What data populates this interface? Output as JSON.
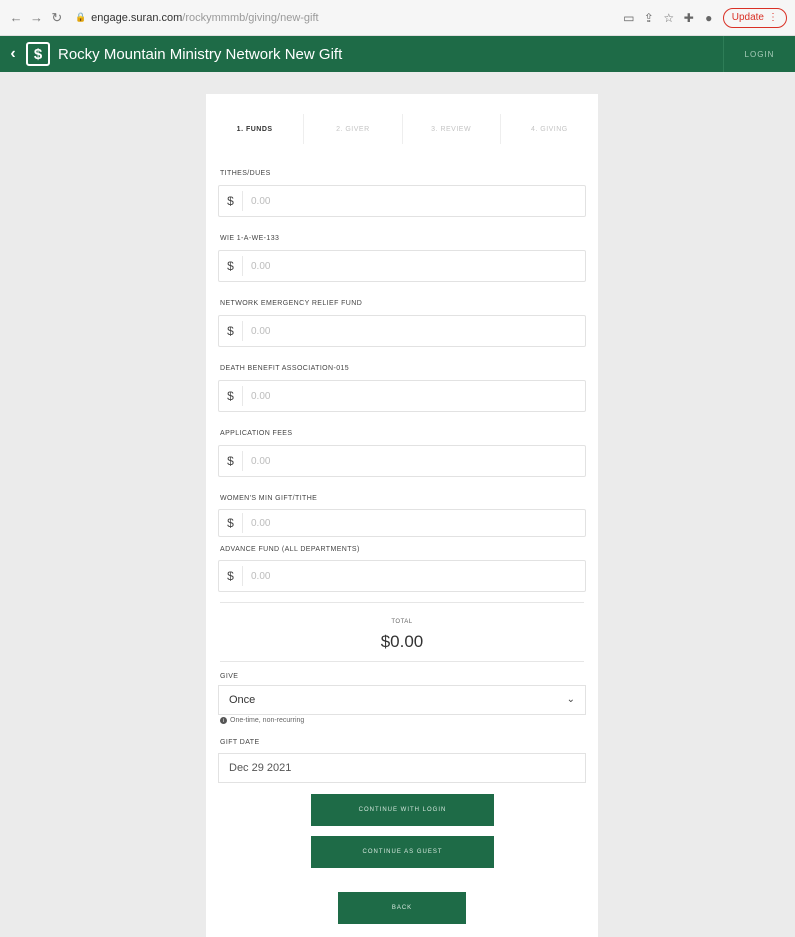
{
  "browser": {
    "url_host": "engage.suran.com",
    "url_path": "/rockymmmb/giving/new-gift",
    "update_label": "Update",
    "icons": [
      "back-icon",
      "forward-icon",
      "reload-icon",
      "lock-icon",
      "cast-icon",
      "share-icon",
      "star-icon",
      "extensions-icon",
      "profile-icon"
    ]
  },
  "app": {
    "back_glyph": "‹",
    "logo_glyph": "$",
    "title": "Rocky Mountain Ministry Network  New Gift",
    "login_label": "LOGIN",
    "brand_color": "#1e6b47"
  },
  "steps": [
    {
      "label": "1. FUNDS",
      "active": true
    },
    {
      "label": "2. GIVER",
      "active": false
    },
    {
      "label": "3. REVIEW",
      "active": false
    },
    {
      "label": "4. GIVING",
      "active": false
    }
  ],
  "funds": [
    {
      "label": "TITHES/DUES",
      "currency": "$",
      "placeholder": "0.00"
    },
    {
      "label": "WIE 1-A-WE-133",
      "currency": "$",
      "placeholder": "0.00"
    },
    {
      "label": "NETWORK EMERGENCY RELIEF FUND",
      "currency": "$",
      "placeholder": "0.00"
    },
    {
      "label": "DEATH BENEFIT ASSOCIATION-015",
      "currency": "$",
      "placeholder": "0.00"
    },
    {
      "label": "APPLICATION FEES",
      "currency": "$",
      "placeholder": "0.00"
    },
    {
      "label": "WOMEN'S MIN GIFT/TITHE",
      "currency": "$",
      "placeholder": "0.00"
    },
    {
      "label": "ADVANCE FUND (ALL DEPARTMENTS)",
      "currency": "$",
      "placeholder": "0.00"
    }
  ],
  "total": {
    "label": "TOTAL",
    "value": "$0.00"
  },
  "frequency": {
    "label": "GIVE",
    "value": "Once",
    "hint": "One-time, non-recurring"
  },
  "gift_date": {
    "label": "GIFT DATE",
    "value": "Dec 29 2021"
  },
  "actions": {
    "continue_login": "CONTINUE WITH LOGIN",
    "continue_guest": "CONTINUE AS GUEST",
    "back": "BACK"
  }
}
